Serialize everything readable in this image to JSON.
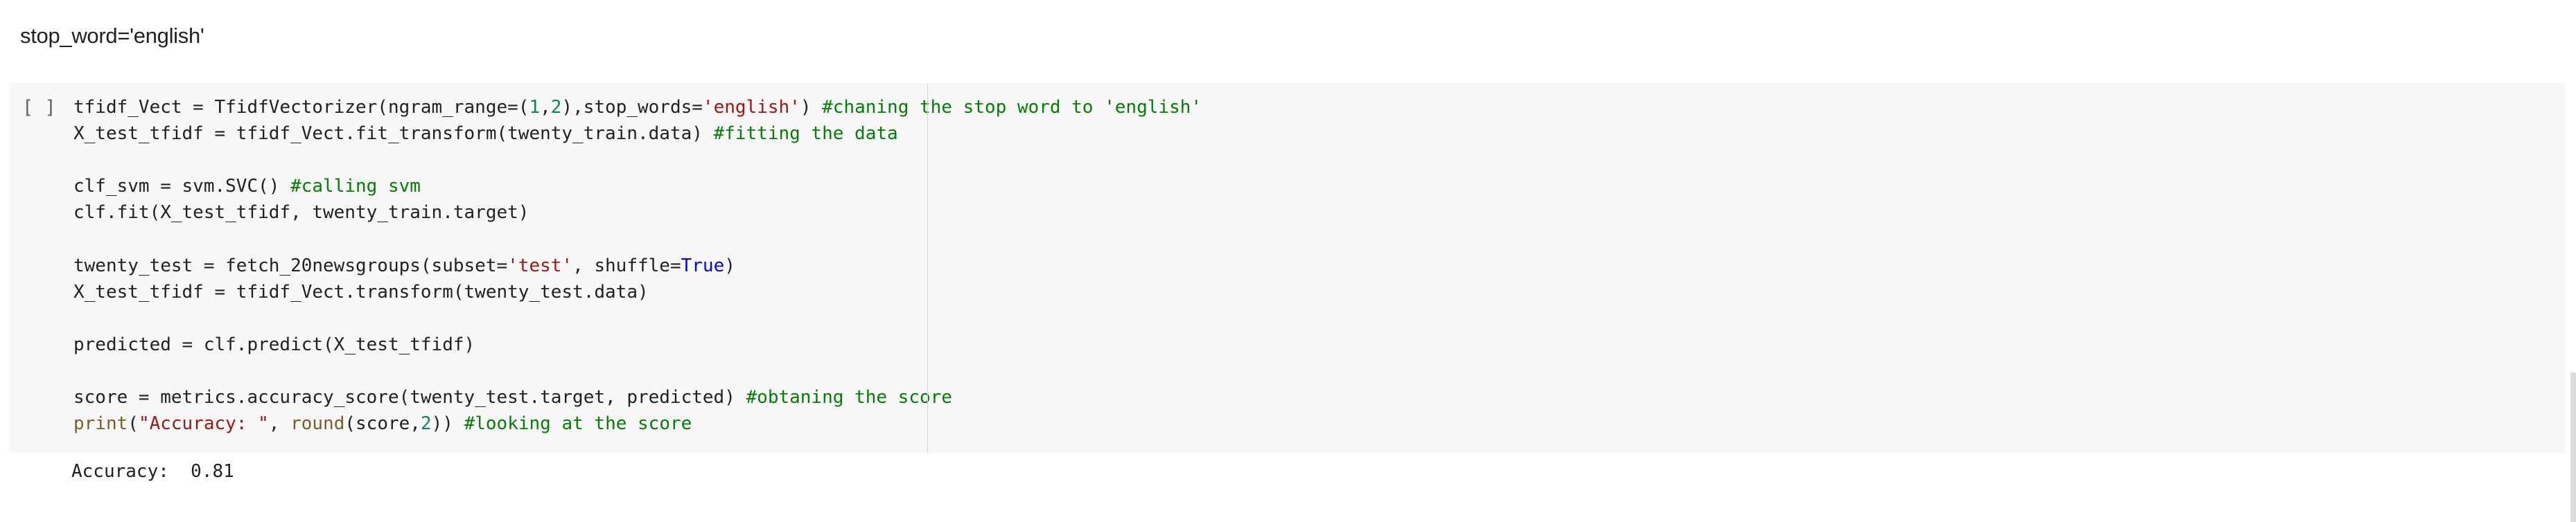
{
  "markdown_cell": {
    "text": "stop_word='english'"
  },
  "code_cell": {
    "run_indicator": "[ ]",
    "lines": [
      [
        {
          "t": "tfidf_Vect = TfidfVectorizer(ngram_range=("
        },
        {
          "t": "1",
          "c": "num"
        },
        {
          "t": ","
        },
        {
          "t": "2",
          "c": "num"
        },
        {
          "t": "),stop_words="
        },
        {
          "t": "'english'",
          "c": "str"
        },
        {
          "t": ") "
        },
        {
          "t": "#chaning the stop word to 'english'",
          "c": "cm"
        }
      ],
      [
        {
          "t": "X_test_tfidf = tfidf_Vect.fit_transform(twenty_train.data) "
        },
        {
          "t": "#fitting the data",
          "c": "cm"
        }
      ],
      [],
      [
        {
          "t": "clf_svm = svm.SVC() "
        },
        {
          "t": "#calling svm",
          "c": "cm"
        }
      ],
      [
        {
          "t": "clf.fit(X_test_tfidf, twenty_train.target)"
        }
      ],
      [],
      [
        {
          "t": "twenty_test = fetch_20newsgroups(subset="
        },
        {
          "t": "'test'",
          "c": "str"
        },
        {
          "t": ", shuffle="
        },
        {
          "t": "True",
          "c": "kw"
        },
        {
          "t": ")"
        }
      ],
      [
        {
          "t": "X_test_tfidf = tfidf_Vect.transform(twenty_test.data)"
        }
      ],
      [],
      [
        {
          "t": "predicted = clf.predict(X_test_tfidf)"
        }
      ],
      [],
      [
        {
          "t": "score = metrics.accuracy_score(twenty_test.target, predicted) "
        },
        {
          "t": "#obtaning the score",
          "c": "cm"
        }
      ],
      [
        {
          "t": "print",
          "c": "builtin"
        },
        {
          "t": "("
        },
        {
          "t": "\"Accuracy: \"",
          "c": "str"
        },
        {
          "t": ", "
        },
        {
          "t": "round",
          "c": "builtin"
        },
        {
          "t": "(score,"
        },
        {
          "t": "2",
          "c": "num"
        },
        {
          "t": ")) "
        },
        {
          "t": "#looking at the score",
          "c": "cm"
        }
      ]
    ]
  },
  "output": {
    "text": "Accuracy:  0.81"
  },
  "colors": {
    "cell_background": "#f7f7f7",
    "string": "#a31515",
    "number": "#098658",
    "keyword": "#0000ff",
    "builtin": "#795e26",
    "comment": "#008000"
  }
}
